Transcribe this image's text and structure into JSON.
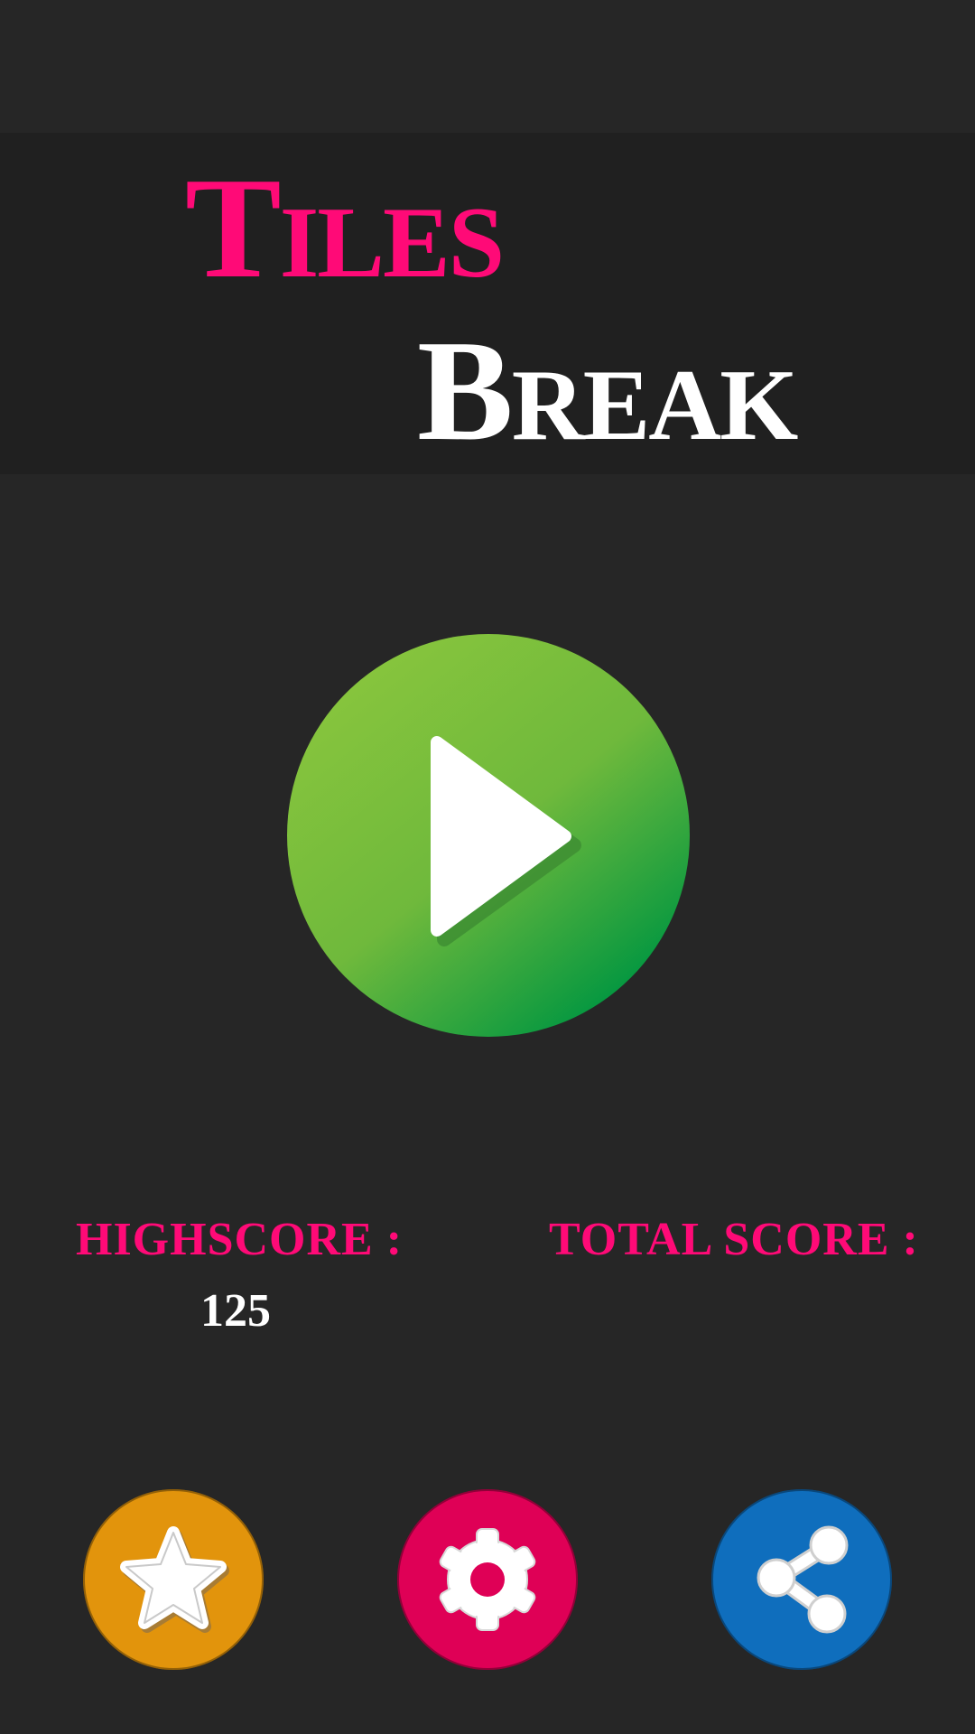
{
  "title": {
    "line1": "Tiles",
    "line2": "Break"
  },
  "scores": {
    "highscore_label": "HIGHSCORE :",
    "highscore_value": "125",
    "total_label": "TOTAL SCORE :",
    "total_value": ""
  },
  "buttons": {
    "play": {
      "icon": "play-icon"
    },
    "rate": {
      "icon": "star-icon"
    },
    "settings": {
      "icon": "gear-icon"
    },
    "share": {
      "icon": "share-icon"
    }
  },
  "colors": {
    "background": "#262626",
    "title_band": "#202020",
    "accent_pink": "#ff0a77",
    "title_white": "#ffffff",
    "play_green_light": "#86c43d",
    "play_green_dark": "#009640",
    "rate_orange": "#e2940c",
    "settings_pink": "#df0056",
    "share_blue": "#0f6ebd"
  }
}
